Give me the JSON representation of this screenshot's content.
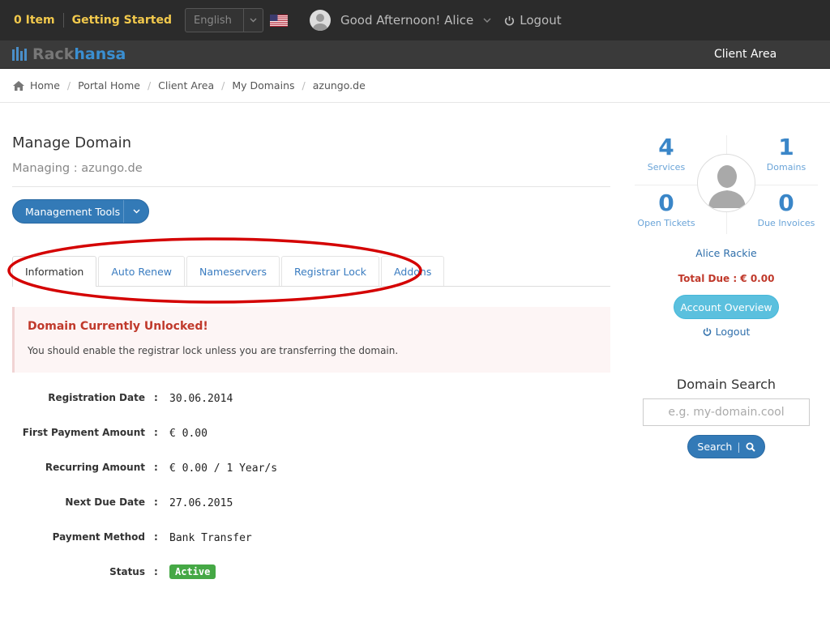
{
  "topbar": {
    "cart": "0 Item",
    "getting_started": "Getting Started",
    "language": "English",
    "greeting": "Good Afternoon! Alice",
    "logout": "Logout"
  },
  "brand": {
    "logo_part1": "Rack",
    "logo_part2": "hansa",
    "nav_client_area": "Client Area"
  },
  "breadcrumb": [
    "Home",
    "Portal Home",
    "Client Area",
    "My Domains",
    "azungo.de"
  ],
  "main": {
    "title": "Manage Domain",
    "subtitle": "Managing : azungo.de",
    "management_tools": "Management Tools",
    "tabs": [
      "Information",
      "Auto Renew",
      "Nameservers",
      "Registrar Lock",
      "Addons"
    ],
    "alert_title": "Domain Currently Unlocked!",
    "alert_text": "You should enable the registrar lock unless you are transferring the domain.",
    "info": [
      {
        "label": "Registration Date",
        "value": "30.06.2014"
      },
      {
        "label": "First Payment Amount",
        "value": "€ 0.00"
      },
      {
        "label": "Recurring Amount",
        "value": "€ 0.00 / 1 Year/s"
      },
      {
        "label": "Next Due Date",
        "value": "27.06.2015"
      },
      {
        "label": "Payment Method",
        "value": "Bank Transfer"
      },
      {
        "label": "Status",
        "value": "Active"
      }
    ]
  },
  "sidebar": {
    "services_count": "4",
    "services_label": "Services",
    "domains_count": "1",
    "domains_label": "Domains",
    "tickets_count": "0",
    "tickets_label": "Open Tickets",
    "invoices_count": "0",
    "invoices_label": "Due Invoices",
    "client_name": "Alice Rackie",
    "total_due": "Total Due : € 0.00",
    "account_overview": "Account Overview",
    "logout": "Logout",
    "domain_search_title": "Domain Search",
    "domain_search_placeholder": "e.g. my-domain.cool",
    "search_button": "Search"
  },
  "colors": {
    "accent_blue": "#337ab7",
    "highlight_ring": "#d40000",
    "alert_red": "#c0392b",
    "status_green": "#45a845"
  }
}
